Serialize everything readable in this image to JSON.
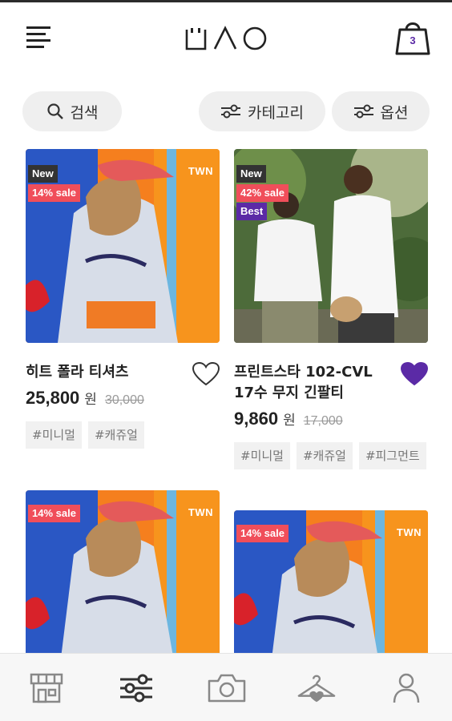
{
  "header": {
    "logo_alt": "UAO",
    "cart_count": "3"
  },
  "filters": {
    "search_label": "검색",
    "category_label": "카테고리",
    "option_label": "옵션"
  },
  "products": [
    {
      "name": "히트 폴라 티셔츠",
      "price": "25,800",
      "currency": "원",
      "original_price": "30,000",
      "badges": [
        "New",
        "14% sale"
      ],
      "brand_mark": "TWN",
      "liked": false,
      "tags": [
        "#미니멀",
        "#캐쥬얼"
      ]
    },
    {
      "name": "프린트스타 102-CVL 17수 무지 긴팔티",
      "name_line1": "프린트스타 102-CVL",
      "name_line2": "17수 무지 긴팔티",
      "price": "9,860",
      "currency": "원",
      "original_price": "17,000",
      "badges": [
        "New",
        "42% sale",
        "Best"
      ],
      "liked": true,
      "tags": [
        "#미니멀",
        "#캐쥬얼",
        "#피그먼트"
      ]
    },
    {
      "badges": [
        "14% sale"
      ],
      "brand_mark": "TWN"
    },
    {
      "badges": [
        "14% sale"
      ],
      "brand_mark": "TWN"
    }
  ],
  "nav": {
    "items": [
      "store-icon",
      "filter-sliders-icon",
      "camera-icon",
      "hanger-heart-icon",
      "user-icon"
    ],
    "active": "filter-sliders-icon"
  },
  "colors": {
    "accent": "#5b2aa6",
    "sale": "#f04e5a",
    "new": "#333333",
    "pill_bg": "#efefef"
  }
}
